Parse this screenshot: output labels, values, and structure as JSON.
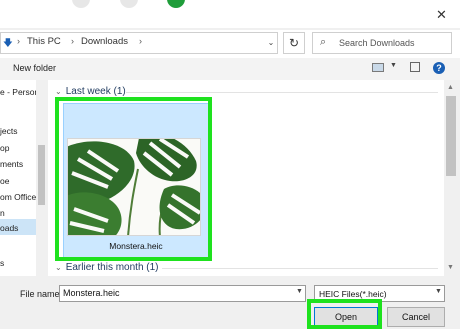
{
  "colors": {
    "accent": "#0078d7",
    "highlight": "#1ee21e",
    "selection": "#cce8ff",
    "help": "#1a5fb4"
  },
  "addressbar": {
    "root_label": "This PC",
    "folder_label": "Downloads",
    "search_placeholder": "Search Downloads"
  },
  "toolbar": {
    "new_folder_label": "New folder",
    "help_label": "?"
  },
  "close_label": "✕",
  "navpane": {
    "items": [
      {
        "label": "e - Person"
      },
      {
        "label": "jects"
      },
      {
        "label": "op"
      },
      {
        "label": "ments"
      },
      {
        "label": "oe"
      },
      {
        "label": "om Office"
      },
      {
        "label": "n"
      },
      {
        "label": "oads"
      },
      {
        "label": "s"
      }
    ]
  },
  "groups": [
    {
      "label": "Last week (1)"
    },
    {
      "label": "Earlier this month (1)"
    }
  ],
  "files": [
    {
      "name": "Monstera.heic",
      "icon": "monstera-image"
    }
  ],
  "footer": {
    "filename_label": "File name:",
    "filename_value": "Monstera.heic",
    "filetype_value": "HEIC Files(*.heic)",
    "open_label": "Open",
    "cancel_label": "Cancel"
  }
}
